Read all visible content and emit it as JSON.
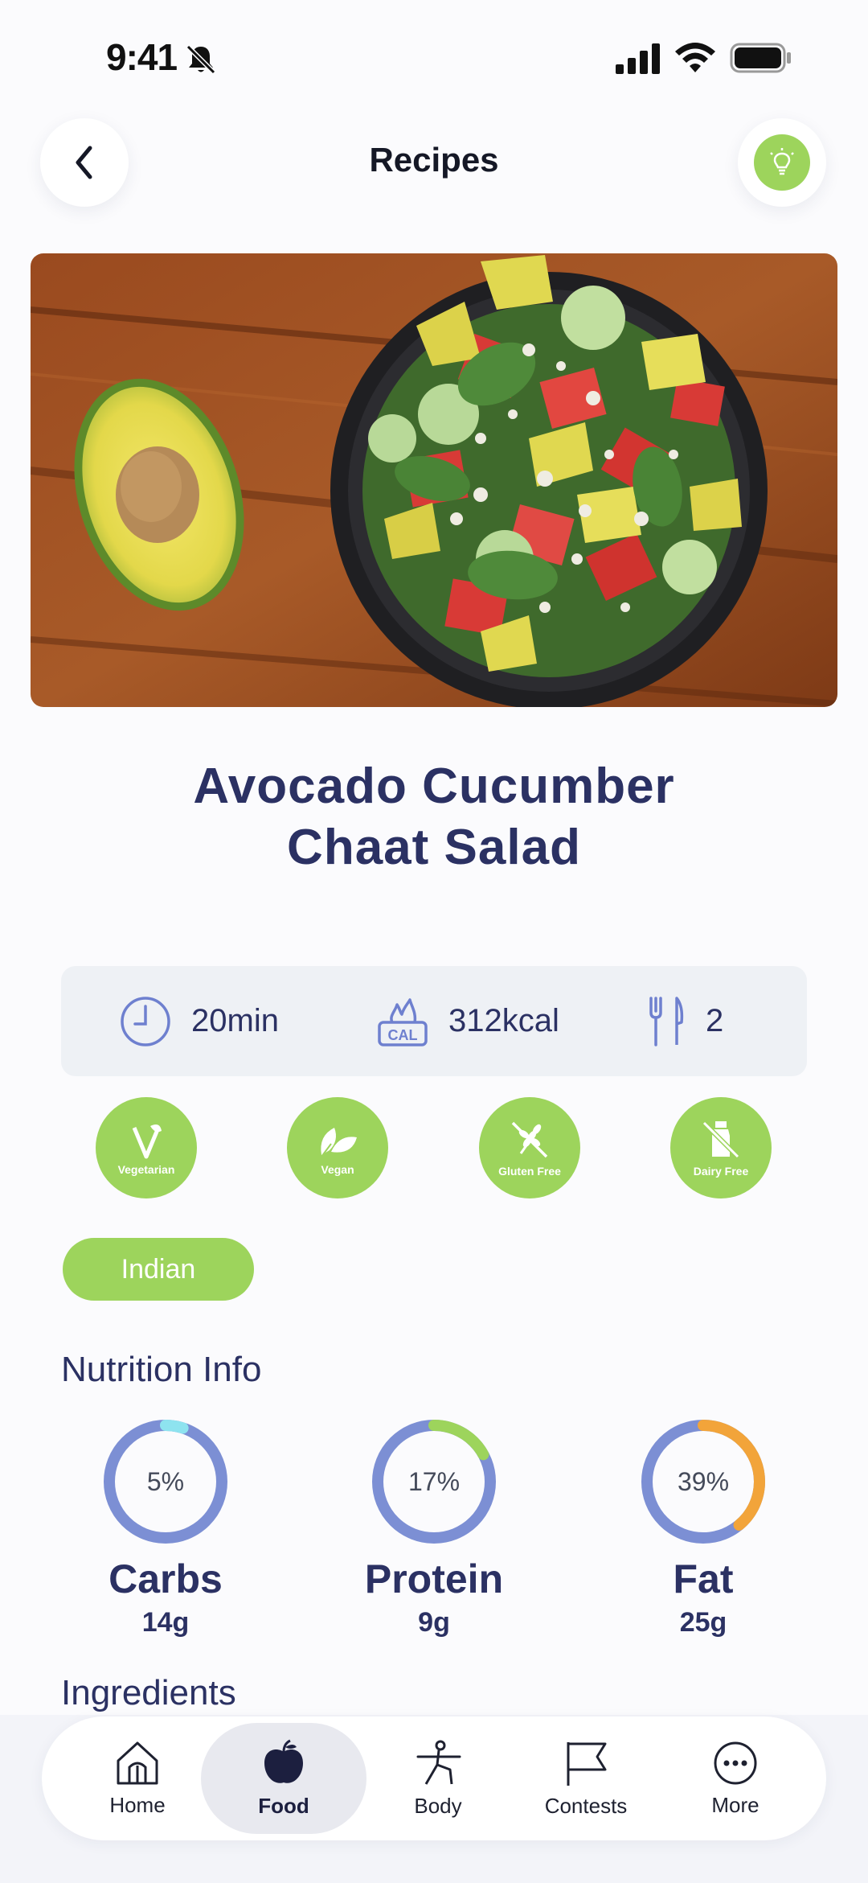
{
  "status_bar": {
    "time": "9:41"
  },
  "header": {
    "title": "Recipes"
  },
  "recipe": {
    "title_line1": "Avocado Cucumber",
    "title_line2": "Chaat Salad"
  },
  "stats": {
    "time": "20min",
    "calories": "312kcal",
    "calories_icon_text": "CAL",
    "servings": "2"
  },
  "diet_badges": [
    {
      "label": "Vegetarian",
      "icon": "vegetarian-icon"
    },
    {
      "label": "Vegan",
      "icon": "vegan-leaf-icon"
    },
    {
      "label": "Gluten Free",
      "icon": "gluten-free-icon"
    },
    {
      "label": "Dairy Free",
      "icon": "dairy-free-icon"
    }
  ],
  "cuisine": "Indian",
  "nutrition": {
    "title": "Nutrition Info",
    "items": [
      {
        "name": "Carbs",
        "percent": 5,
        "percent_label": "5%",
        "amount": "14g",
        "color": "#8ee3ef"
      },
      {
        "name": "Protein",
        "percent": 17,
        "percent_label": "17%",
        "amount": "9g",
        "color": "#9dd45c"
      },
      {
        "name": "Fat",
        "percent": 39,
        "percent_label": "39%",
        "amount": "25g",
        "color": "#f2a43a"
      }
    ],
    "ring_base_color": "#7c8fd4"
  },
  "ingredients_title": "Ingredients",
  "tabbar": {
    "items": [
      {
        "label": "Home",
        "icon": "home-icon"
      },
      {
        "label": "Food",
        "icon": "apple-icon",
        "active": true
      },
      {
        "label": "Body",
        "icon": "yoga-pose-icon"
      },
      {
        "label": "Contests",
        "icon": "flag-icon"
      },
      {
        "label": "More",
        "icon": "more-dots-icon"
      }
    ]
  },
  "colors": {
    "accent_green": "#9dd45c",
    "navy": "#2b3163"
  }
}
